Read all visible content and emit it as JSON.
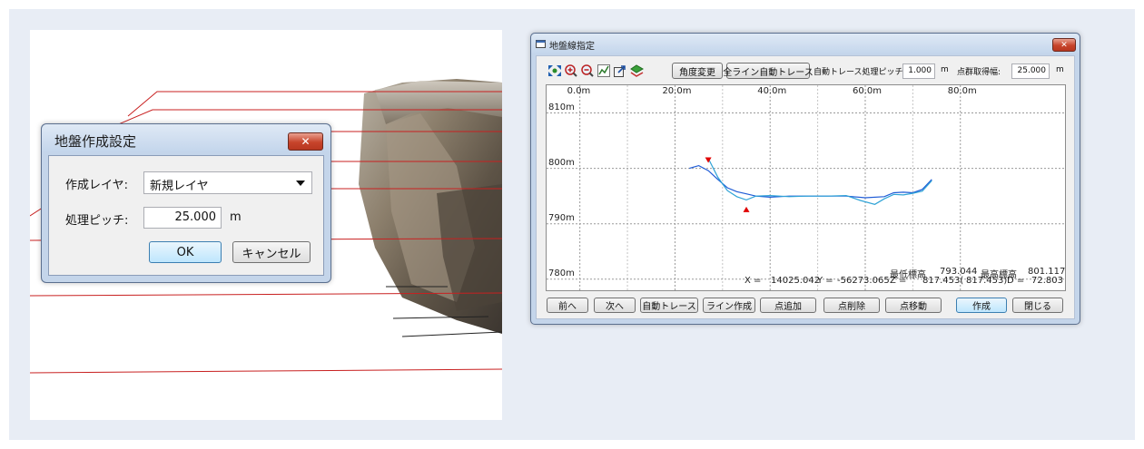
{
  "ground_dialog": {
    "title": "地盤作成設定",
    "layer_label": "作成レイヤ:",
    "layer_value": "新規レイヤ",
    "pitch_label": "処理ピッチ:",
    "pitch_value": "25.000",
    "pitch_unit": "m",
    "ok_label": "OK",
    "cancel_label": "キャンセル",
    "close_glyph": "✕"
  },
  "line_dialog": {
    "title": "地盤線指定",
    "close_glyph": "✕",
    "toolbar": {
      "icons": [
        "zoom-fit-icon",
        "zoom-in-icon",
        "zoom-out-icon",
        "chart-icon",
        "export-icon",
        "layer-icon"
      ],
      "angle_button": "角度変更",
      "auto_all_button": "全ライン自動トレース",
      "pitch_label": "自動トレース処理ピッチ:",
      "pitch_value": "1.000",
      "pitch_unit": "m",
      "width_label": "点群取得幅:",
      "width_value": "25.000",
      "width_unit": "m"
    },
    "readout": {
      "x_label": "X =",
      "x_value": "14025.042",
      "y_label": "Y =",
      "y_value": "-56273.065",
      "z_label": "Z =",
      "z_value": "817.453(",
      "z_paren": "817.453)",
      "d_label": "D =",
      "d_value": "72.803",
      "min_label": "最低標高",
      "min_value": "793.044",
      "max_label": "最高標高",
      "max_value": "801.117"
    },
    "buttons": {
      "prev": "前へ",
      "next": "次へ",
      "auto_trace": "自動トレース",
      "line_create": "ライン作成",
      "add_point": "点追加",
      "delete_point": "点削除",
      "move_point": "点移動",
      "create": "作成",
      "close": "閉じる"
    }
  },
  "chart_data": {
    "type": "line",
    "x_ticks": [
      "0.0m",
      "20.0m",
      "40.0m",
      "60.0m",
      "80.0m"
    ],
    "x_tick_values": [
      0,
      20,
      40,
      60,
      80
    ],
    "y_ticks": [
      "810m",
      "800m",
      "790m",
      "780m"
    ],
    "y_tick_values": [
      810,
      800,
      790,
      780
    ],
    "xlim": [
      -7,
      102
    ],
    "ylim": [
      778,
      815
    ],
    "grid": true,
    "series": [
      {
        "color": "#1e5bd6",
        "x": [
          23,
          25,
          27,
          29,
          31,
          33,
          35,
          37,
          40,
          44,
          48,
          52,
          56,
          60,
          64,
          66,
          68,
          70,
          72,
          74
        ],
        "y": [
          800.0,
          800.5,
          799.6,
          798.0,
          796.5,
          795.8,
          795.4,
          795.0,
          794.8,
          795.0,
          795.0,
          795.0,
          795.0,
          794.7,
          794.9,
          795.6,
          795.7,
          795.6,
          796.2,
          798.0
        ]
      },
      {
        "color": "#2fa3d6",
        "x": [
          27,
          29,
          31,
          33,
          35,
          37,
          40,
          44,
          48,
          52,
          56,
          59,
          62,
          64,
          66,
          68,
          70,
          72,
          74
        ],
        "y": [
          801.8,
          798.4,
          796.0,
          794.9,
          794.3,
          795.0,
          795.1,
          794.9,
          795.0,
          795.0,
          795.1,
          794.2,
          793.5,
          794.5,
          795.3,
          795.2,
          795.5,
          795.9,
          797.8
        ]
      }
    ],
    "markers": [
      {
        "x": 27,
        "y": 801.5,
        "dir": "down",
        "color": "#e00000"
      },
      {
        "x": 35,
        "y": 792.6,
        "dir": "up",
        "color": "#e00000"
      }
    ]
  }
}
